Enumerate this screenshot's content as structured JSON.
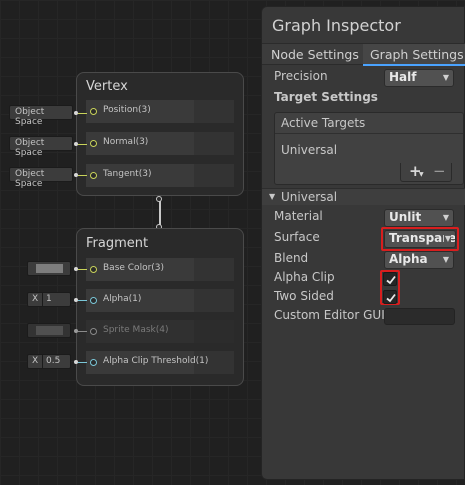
{
  "graph": {
    "vertex": {
      "title": "Vertex",
      "ports": [
        {
          "label": "Position(3)",
          "input": "Object Space"
        },
        {
          "label": "Normal(3)",
          "input": "Object Space"
        },
        {
          "label": "Tangent(3)",
          "input": "Object Space"
        }
      ]
    },
    "fragment": {
      "title": "Fragment",
      "ports": [
        {
          "label": "Base Color(3)"
        },
        {
          "label": "Alpha(1)",
          "input_prefix": "X",
          "input_value": "1"
        },
        {
          "label": "Sprite Mask(4)"
        },
        {
          "label": "Alpha Clip Threshold(1)",
          "input_prefix": "X",
          "input_value": "0.5"
        }
      ]
    }
  },
  "inspector": {
    "title": "Graph Inspector",
    "tabs": [
      "Node Settings",
      "Graph Settings"
    ],
    "precision_label": "Precision",
    "precision_value": "Half",
    "target_settings_label": "Target Settings",
    "active_targets_label": "Active Targets",
    "active_targets": [
      "Universal"
    ],
    "add_label": "+",
    "remove_label": "−",
    "universal_section": "Universal",
    "material_label": "Material",
    "material_value": "Unlit",
    "surface_label": "Surface",
    "surface_value": "Transparent",
    "blend_label": "Blend",
    "blend_value": "Alpha",
    "alpha_clip_label": "Alpha Clip",
    "alpha_clip_checked": true,
    "two_sided_label": "Two Sided",
    "two_sided_checked": true,
    "custom_editor_label": "Custom Editor GUI",
    "custom_editor_value": ""
  },
  "colors": {
    "vector3_port": "#c9d35a",
    "float_port": "#7ac7d8",
    "highlight": "#d81e1e"
  }
}
